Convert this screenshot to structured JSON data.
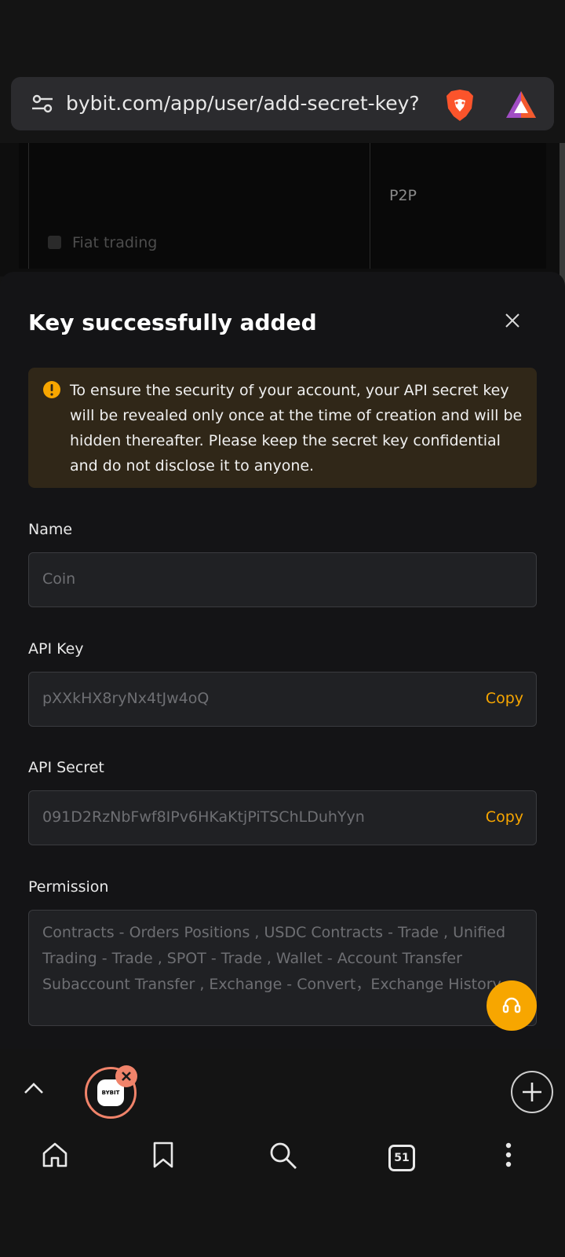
{
  "browser": {
    "url": "bybit.com/app/user/add-secret-key?",
    "tabs_count": "51",
    "active_tab_label": "BYBIT"
  },
  "background_page": {
    "p2p_label": "P2P",
    "fiat_trading_label": "Fiat trading"
  },
  "modal": {
    "title": "Key successfully added",
    "warning": "To ensure the security of your account, your API secret key will be revealed only once at the time of creation and will be hidden thereafter. Please keep the secret key confidential and do not disclose it to anyone.",
    "name_label": "Name",
    "name_value": "Coin",
    "api_key_label": "API Key",
    "api_key_value": "pXXkHX8ryNx4tJw4oQ",
    "api_secret_label": "API Secret",
    "api_secret_value": "091D2RzNbFwf8IPv6HKaKtjPiTSChLDuhYyn",
    "copy_label": "Copy",
    "permission_label": "Permission",
    "permission_value": "Contracts - Orders Positions  , USDC Contracts - Trade  , Unified Trading - Trade  , SPOT - Trade  , Wallet - Account Transfer Subaccount Transfer  , Exchange - Convert，Exchange History"
  },
  "colors": {
    "accent": "#f7a600",
    "warning_bg": "#302718",
    "tab_bubble": "#f0836a"
  }
}
